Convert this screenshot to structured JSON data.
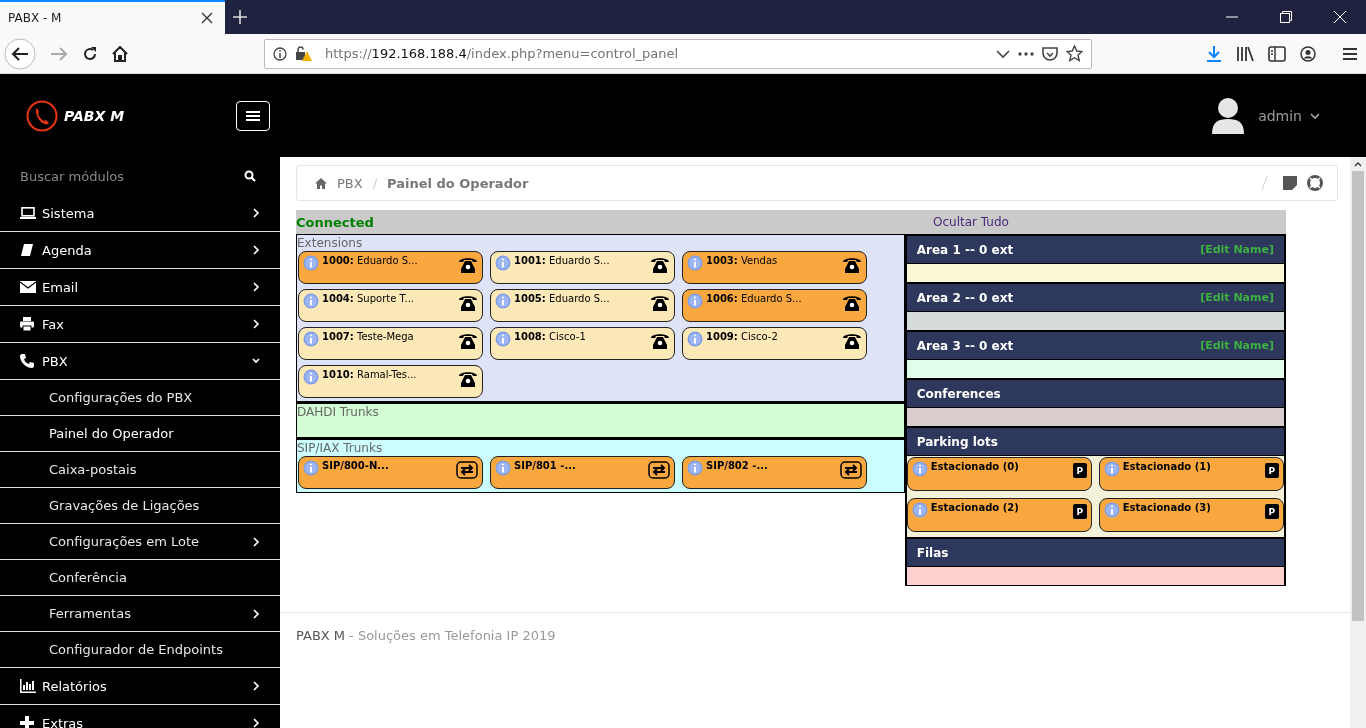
{
  "browser": {
    "tab_title": "PABX - M",
    "url_scheme": "https://",
    "url_host": "192.168.188.4",
    "url_path": "/index.php?menu=control_panel"
  },
  "header": {
    "brand": "PABX M",
    "user": "admin"
  },
  "sidebar": {
    "search_placeholder": "Buscar módulos",
    "items": [
      {
        "label": "Sistema",
        "expanded": false
      },
      {
        "label": "Agenda",
        "expanded": false
      },
      {
        "label": "Email",
        "expanded": false
      },
      {
        "label": "Fax",
        "expanded": false
      },
      {
        "label": "PBX",
        "expanded": true,
        "children": [
          {
            "label": "Configurações do PBX",
            "has_submenu": false,
            "selected": false
          },
          {
            "label": "Painel do Operador",
            "has_submenu": false,
            "selected": true
          },
          {
            "label": "Caixa-postais",
            "has_submenu": false,
            "selected": false
          },
          {
            "label": "Gravações de Ligações",
            "has_submenu": false,
            "selected": false
          },
          {
            "label": "Configurações em Lote",
            "has_submenu": true,
            "selected": false
          },
          {
            "label": "Conferência",
            "has_submenu": false,
            "selected": false
          },
          {
            "label": "Ferramentas",
            "has_submenu": true,
            "selected": false
          },
          {
            "label": "Configurador de Endpoints",
            "has_submenu": false,
            "selected": false
          }
        ]
      },
      {
        "label": "Relatórios",
        "expanded": false
      },
      {
        "label": "Extras",
        "expanded": false
      }
    ]
  },
  "breadcrumb": {
    "separator": "/",
    "items": [
      "PBX",
      "Painel do Operador"
    ]
  },
  "panel": {
    "status": "Connected",
    "hide_all": "Ocultar Tudo",
    "sections": [
      {
        "title": "Extensions",
        "color": "#dfe3f8",
        "kind": "phone",
        "cards": [
          {
            "label": "**1000:** Eduardo S...",
            "highlighted": true
          },
          {
            "label": "**1001:** Eduardo S...",
            "highlighted": false
          },
          {
            "label": "**1003:** Vendas",
            "highlighted": true
          },
          {
            "label": "**1004:** Suporte T...",
            "highlighted": false
          },
          {
            "label": "**1005:** Eduardo S...",
            "highlighted": false
          },
          {
            "label": "**1006:** Eduardo S...",
            "highlighted": true
          },
          {
            "label": "**1007:** Teste-Mega",
            "highlighted": false
          },
          {
            "label": "**1008:** Cisco-1",
            "highlighted": false
          },
          {
            "label": "**1009:** Cisco-2",
            "highlighted": false
          },
          {
            "label": "**1010:** Ramal-Tes...",
            "highlighted": false
          }
        ]
      },
      {
        "title": "DAHDI Trunks",
        "color": "#d3fdd3"
      },
      {
        "title": "SIP/IAX Trunks",
        "color": "#cdfefe",
        "kind": "trunk",
        "cards": [
          {
            "label": "**SIP/800-N...**",
            "highlighted": true
          },
          {
            "label": "**SIP/801 -...**",
            "highlighted": true
          },
          {
            "label": "**SIP/802 -...**",
            "highlighted": true
          }
        ]
      }
    ],
    "areas": [
      {
        "title": "Area 1 -- 0 ext",
        "edit": "[Edit Name]",
        "color": "#fbf6d5"
      },
      {
        "title": "Area 2 -- 0 ext",
        "edit": "[Edit Name]",
        "color": "#d4dbd9"
      },
      {
        "title": "Area 3 -- 0 ext",
        "edit": "[Edit Name]",
        "color": "#e0fdea"
      },
      {
        "title": "Conferences",
        "color": "#d9cccc"
      },
      {
        "title": "Parking lots",
        "color": "#f3f1da",
        "cards": [
          {
            "label": "**Estacionado (0)**",
            "badge": "P",
            "highlighted": true
          },
          {
            "label": "**Estacionado (1)**",
            "badge": "P",
            "highlighted": true
          },
          {
            "label": "**Estacionado (2)**",
            "badge": "P",
            "highlighted": true
          },
          {
            "label": "**Estacionado (3)**",
            "badge": "P",
            "highlighted": true
          }
        ]
      },
      {
        "title": "Filas",
        "color": "#fdd0d0"
      }
    ]
  },
  "footer": {
    "brand": "PABX M",
    "text": "- Soluções em Telefonia IP 2019"
  }
}
